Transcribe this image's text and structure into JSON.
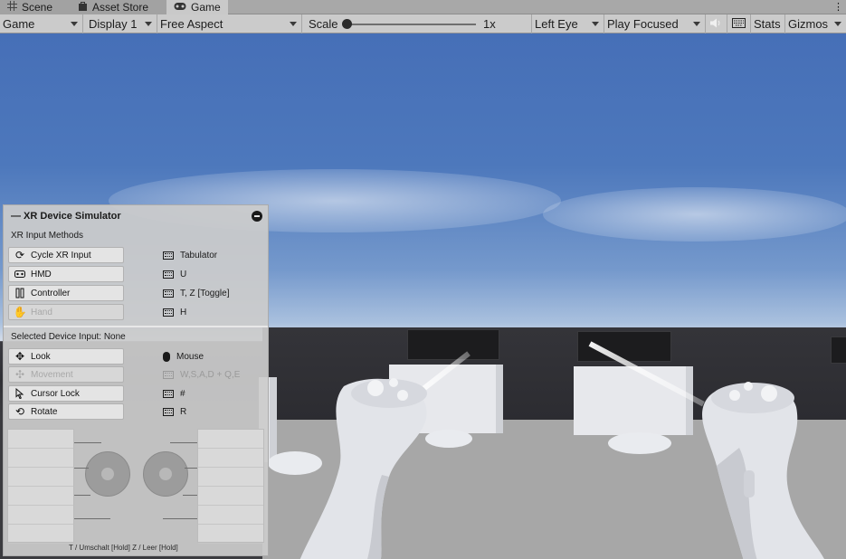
{
  "tabs": [
    {
      "label": "Scene",
      "icon": "grid-icon"
    },
    {
      "label": "Asset Store",
      "icon": "bag-icon"
    },
    {
      "label": "Game",
      "icon": "gamepad-icon"
    }
  ],
  "toolbar": {
    "game_view": "Game",
    "display": "Display 1",
    "aspect": "Free Aspect",
    "scale_label": "Scale",
    "scale_value": "1x",
    "eye": "Left Eye",
    "play_mode": "Play Focused",
    "stats": "Stats",
    "gizmos": "Gizmos"
  },
  "simulator": {
    "title": "— XR Device Simulator",
    "input_methods_label": "XR Input Methods",
    "methods": [
      {
        "label": "Cycle XR Input",
        "icon": "cycle-icon",
        "key": "Tabulator",
        "disabled": false
      },
      {
        "label": "HMD",
        "icon": "hmd-icon",
        "key": "U",
        "disabled": false
      },
      {
        "label": "Controller",
        "icon": "controller-icon",
        "key": "T, Z [Toggle]",
        "disabled": false
      },
      {
        "label": "Hand",
        "icon": "hand-icon",
        "key": "H",
        "disabled": true
      }
    ],
    "selected_device_label": "Selected Device Input:  None",
    "actions": [
      {
        "label": "Look",
        "icon": "move-icon",
        "key": "Mouse",
        "key_icon": "mouse-icon",
        "disabled": false
      },
      {
        "label": "Movement",
        "icon": "movement-icon",
        "key": "W,S,A,D + Q,E",
        "key_icon": "keyboard-icon",
        "disabled": true
      },
      {
        "label": "Cursor Lock",
        "icon": "cursor-icon",
        "key": "#",
        "key_icon": "keyboard-icon",
        "disabled": false
      },
      {
        "label": "Rotate",
        "icon": "rotate-icon",
        "key": "R",
        "key_icon": "keyboard-icon",
        "disabled": false
      }
    ],
    "footer": "T / Umschalt [Hold]  Z / Leer [Hold]"
  }
}
